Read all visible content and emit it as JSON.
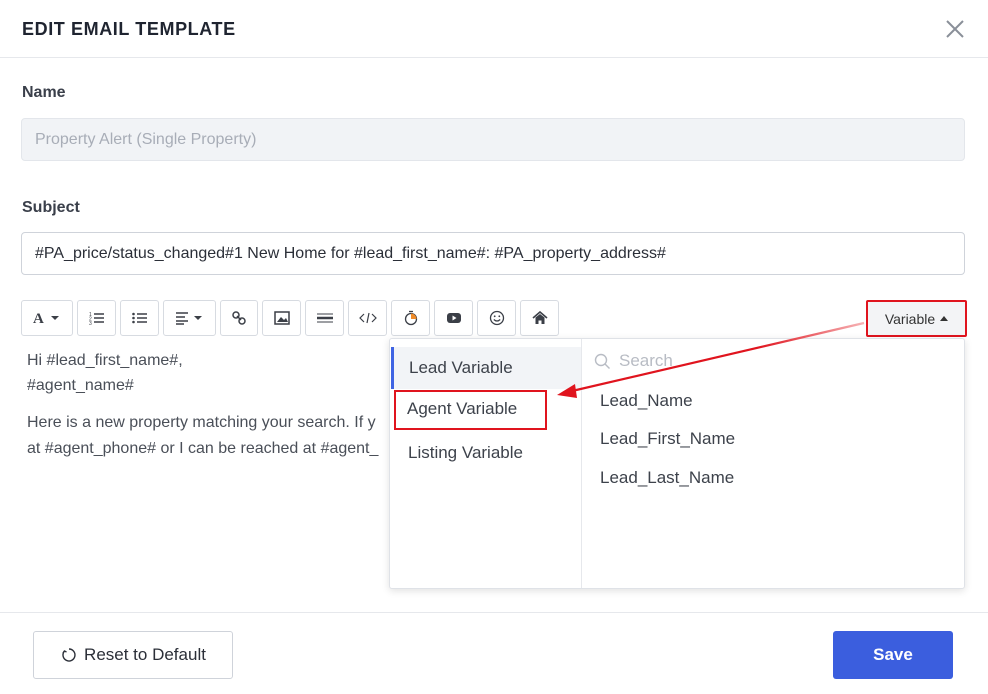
{
  "header": {
    "title": "EDIT EMAIL TEMPLATE",
    "close_icon": "close-icon"
  },
  "name": {
    "label": "Name",
    "value": "Property Alert (Single Property)"
  },
  "subject": {
    "label": "Subject",
    "value": "#PA_price/status_changed#1 New Home for #lead_first_name#: #PA_property_address#"
  },
  "toolbar": {
    "buttons": [
      "font-icon",
      "ordered-list-icon",
      "unordered-list-icon",
      "align-icon",
      "link-icon",
      "image-icon",
      "horizontal-rule-icon",
      "code-icon",
      "timer-icon",
      "video-icon",
      "emoji-icon",
      "home-icon"
    ],
    "variable_label": "Variable"
  },
  "editor": {
    "line1": "Hi #lead_first_name#,",
    "line2": "#agent_name#",
    "line3": "Here is a new property matching your search. If y",
    "line4": "at #agent_phone# or I can be reached at #agent_"
  },
  "dropdown": {
    "categories": [
      "Lead Variable",
      "Agent Variable",
      "Listing Variable"
    ],
    "active_category": "Lead Variable",
    "search_placeholder": "Search",
    "items": [
      "Lead_Name",
      "Lead_First_Name",
      "Lead_Last_Name"
    ]
  },
  "footer": {
    "reset_label": "Reset to Default",
    "save_label": "Save"
  },
  "colors": {
    "accent": "#3b5ede",
    "annotation": "#e0141e"
  }
}
